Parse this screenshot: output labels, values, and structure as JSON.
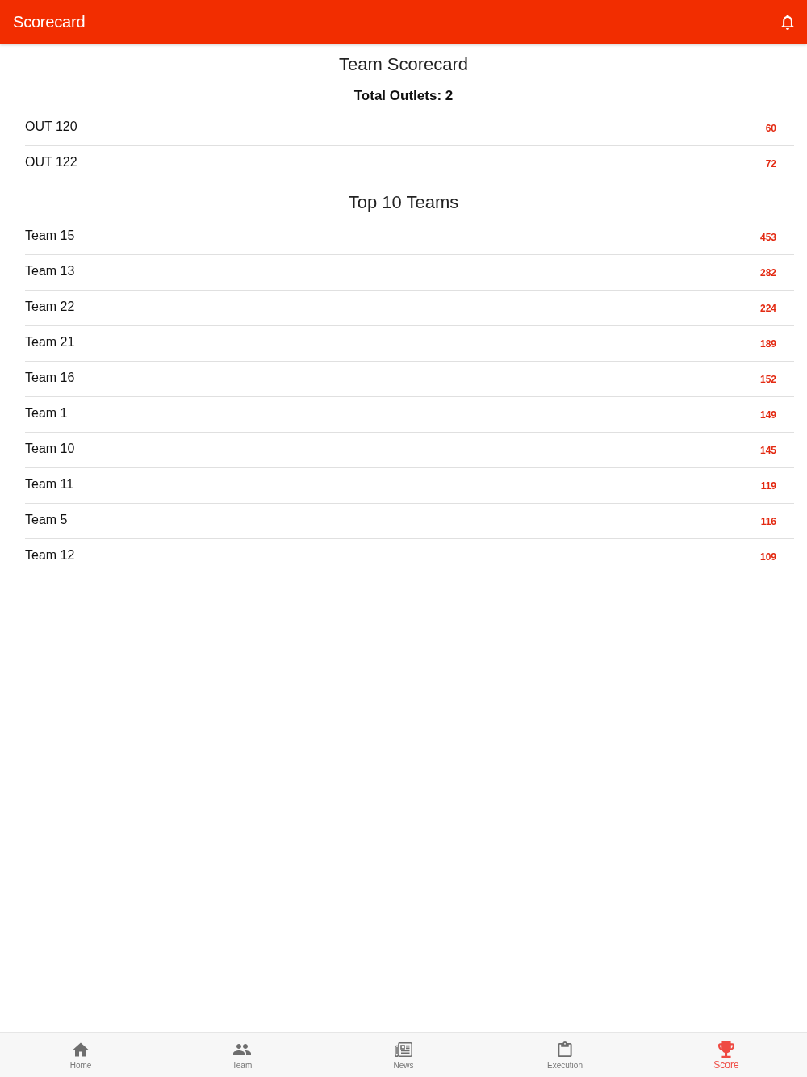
{
  "app_bar": {
    "title": "Scorecard"
  },
  "team_scorecard": {
    "title": "Team Scorecard",
    "total_outlets": "Total Outlets: 2",
    "outlets": [
      {
        "name": "OUT 120",
        "score": "60"
      },
      {
        "name": "OUT 122",
        "score": "72"
      }
    ]
  },
  "top_teams": {
    "title": "Top 10 Teams",
    "teams": [
      {
        "name": "Team 15",
        "score": "453"
      },
      {
        "name": "Team 13",
        "score": "282"
      },
      {
        "name": "Team 22",
        "score": "224"
      },
      {
        "name": "Team 21",
        "score": "189"
      },
      {
        "name": "Team 16",
        "score": "152"
      },
      {
        "name": "Team 1",
        "score": "149"
      },
      {
        "name": "Team 10",
        "score": "145"
      },
      {
        "name": "Team 11",
        "score": "119"
      },
      {
        "name": "Team 5",
        "score": "116"
      },
      {
        "name": "Team 12",
        "score": "109"
      }
    ]
  },
  "bottom_nav": [
    {
      "label": "Home",
      "kind": "home",
      "selected": false
    },
    {
      "label": "Team",
      "kind": "team",
      "selected": false
    },
    {
      "label": "News",
      "kind": "news",
      "selected": false
    },
    {
      "label": "Execution",
      "kind": "execution",
      "selected": false
    },
    {
      "label": "Score",
      "kind": "score",
      "selected": true
    }
  ]
}
